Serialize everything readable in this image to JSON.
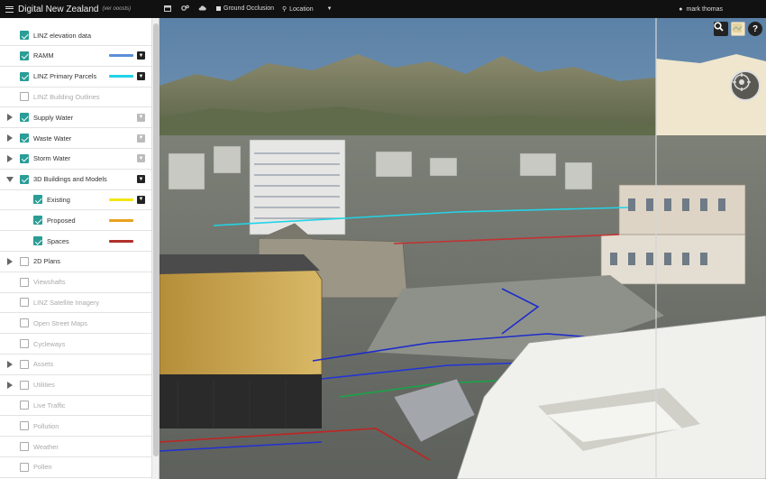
{
  "header": {
    "title": "Digital New Zealand",
    "version": "(ver ooosts)",
    "ground_occlusion": "Ground Occlusion",
    "location": "Location",
    "user": "mark thomas"
  },
  "layers": [
    {
      "label": "LINZ elevation data",
      "checked": true,
      "enabled": true
    },
    {
      "label": "RAMM",
      "checked": true,
      "enabled": true,
      "swatch": "#5b8fd6",
      "filter": "dark"
    },
    {
      "label": "LINZ Primary Parcels",
      "checked": true,
      "enabled": true,
      "swatch": "#22d3e6",
      "filter": "dark"
    },
    {
      "label": "LINZ Building Outlines",
      "checked": false,
      "enabled": false
    },
    {
      "label": "Supply Water",
      "checked": true,
      "enabled": true,
      "expander": "closed",
      "filter": "dim"
    },
    {
      "label": "Waste Water",
      "checked": true,
      "enabled": true,
      "expander": "closed",
      "filter": "dim"
    },
    {
      "label": "Storm Water",
      "checked": true,
      "enabled": true,
      "expander": "closed",
      "filter": "dim"
    },
    {
      "label": "3D Buildings and Models",
      "checked": true,
      "enabled": true,
      "expander": "open",
      "filter": "dark"
    },
    {
      "label": "Existing",
      "checked": true,
      "enabled": true,
      "child": true,
      "swatch": "#f2e614",
      "filter": "dark"
    },
    {
      "label": "Proposed",
      "checked": true,
      "enabled": true,
      "child": true,
      "swatch": "#e9a11e"
    },
    {
      "label": "Spaces",
      "checked": true,
      "enabled": true,
      "child": true,
      "swatch": "#b0302c"
    },
    {
      "label": "2D Plans",
      "checked": false,
      "enabled": true,
      "expander": "closed"
    },
    {
      "label": "Viewshafts",
      "checked": false,
      "enabled": false
    },
    {
      "label": "LINZ Satellite Imagery",
      "checked": false,
      "enabled": false
    },
    {
      "label": "Open Street Maps",
      "checked": false,
      "enabled": false
    },
    {
      "label": "Cycleways",
      "checked": false,
      "enabled": false
    },
    {
      "label": "Assets",
      "checked": false,
      "enabled": false,
      "expander": "closed"
    },
    {
      "label": "Utilities",
      "checked": false,
      "enabled": false,
      "expander": "closed"
    },
    {
      "label": "Live Traffic",
      "checked": false,
      "enabled": false
    },
    {
      "label": "Pollution",
      "checked": false,
      "enabled": false
    },
    {
      "label": "Weather",
      "checked": false,
      "enabled": false
    },
    {
      "label": "Pollen",
      "checked": false,
      "enabled": false
    }
  ],
  "map_tools": {
    "search": "search-icon",
    "basemap": "basemap-icon",
    "help": "?",
    "compass": "compass-icon"
  },
  "colors": {
    "topbar": "#111111",
    "checkbox": "#2a9d96",
    "sky": "#6e8fad"
  }
}
